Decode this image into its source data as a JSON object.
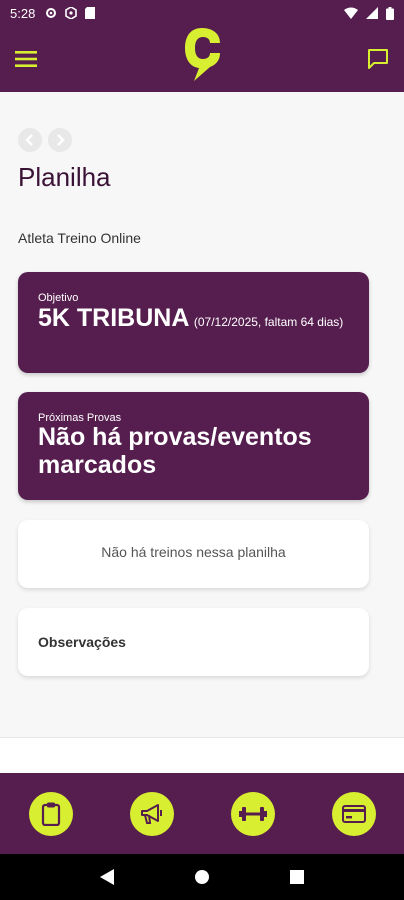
{
  "status_bar": {
    "time": "5:28"
  },
  "page": {
    "title": "Planilha",
    "athlete_type": "Atleta Treino Online"
  },
  "objetivo": {
    "label": "Objetivo",
    "name": "5K TRIBUNA",
    "details": "(07/12/2025, faltam 64 dias)"
  },
  "proximas": {
    "label": "Próximas Provas",
    "message": "Não há provas/eventos marcados"
  },
  "treinos": {
    "empty_message": "Não há treinos nessa planilha"
  },
  "observacoes": {
    "title": "Observações"
  },
  "colors": {
    "brand_purple": "#561e4f",
    "accent_lime": "#d8ee30"
  },
  "icons": {
    "app_bar": [
      "menu-icon",
      "logo",
      "chat-icon"
    ],
    "bottom_nav": [
      "clipboard-icon",
      "megaphone-icon",
      "dumbbell-icon",
      "card-icon"
    ]
  }
}
